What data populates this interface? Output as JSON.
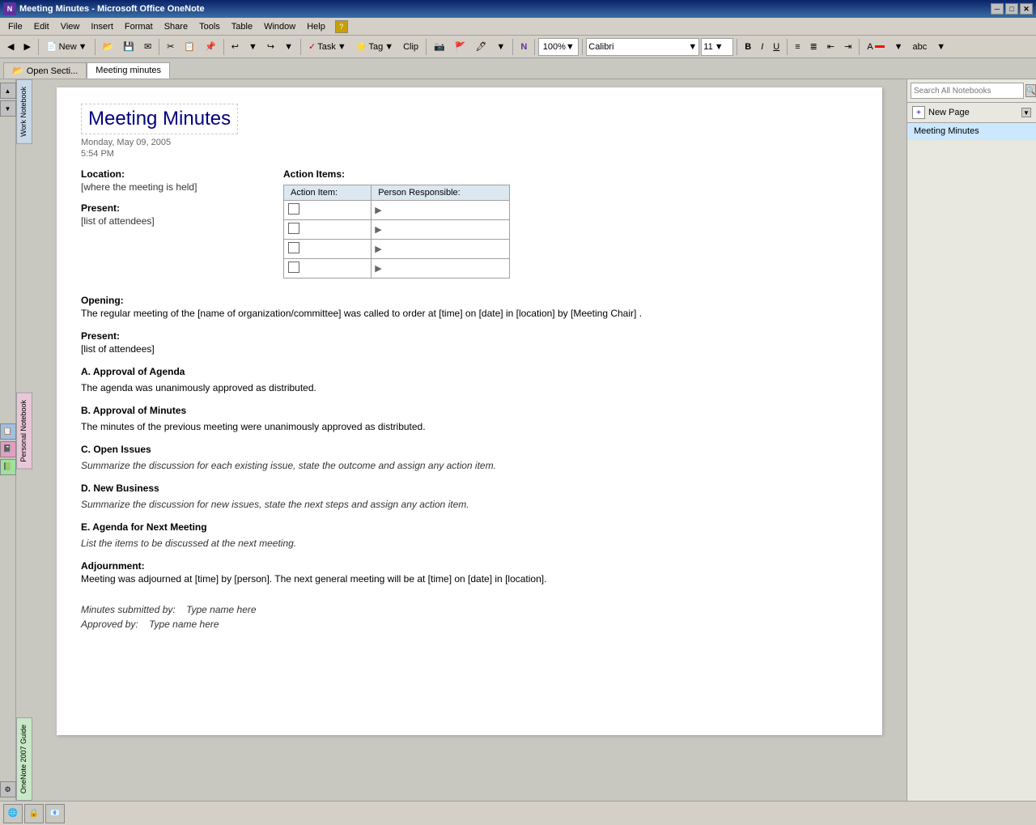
{
  "titlebar": {
    "title": "Meeting Minutes - Microsoft Office OneNote",
    "min_btn": "─",
    "max_btn": "□",
    "close_btn": "✕"
  },
  "menubar": {
    "items": [
      "File",
      "Edit",
      "View",
      "Insert",
      "Format",
      "Share",
      "Tools",
      "Table",
      "Window",
      "Help"
    ]
  },
  "toolbar": {
    "new_label": "New",
    "zoom_value": "100%",
    "font_name": "Calibri",
    "font_size": "11",
    "task_label": "Task",
    "tag_label": "Tag",
    "clip_label": "Clip"
  },
  "tabs": {
    "open_section": "Open Secti...",
    "active_tab": "Meeting minutes"
  },
  "sidebar": {
    "work_notebook": "Work Notebook",
    "personal_notebook": "Personal Notebook",
    "guide": "OneNote 2007 Guide"
  },
  "right_panel": {
    "search_placeholder": "Search All Notebooks",
    "new_page_label": "New Page",
    "pages": [
      "Meeting Minutes"
    ]
  },
  "document": {
    "title": "Meeting Minutes",
    "date": "Monday, May 09, 2005",
    "time": "5:54 PM",
    "location_label": "Location:",
    "location_value": "[where the meeting is held]",
    "present_label": "Present:",
    "present_value": "[list of attendees]",
    "action_items": {
      "title": "Action Items:",
      "col1": "Action Item:",
      "col2": "Person Responsible:",
      "rows": 4
    },
    "opening_label": "Opening:",
    "opening_text": "The regular meeting of the [name of organization/committee]  was called to order at [time] on [date] in [location] by [Meeting Chair] .",
    "present2_label": "Present:",
    "present2_text": "[list of attendees]",
    "agenda_a_label": "A.   Approval of Agenda",
    "agenda_a_text": "The agenda was unanimously  approved as distributed.",
    "agenda_b_label": "B.   Approval of Minutes",
    "agenda_b_text": "The minutes  of the previous meeting were unanimously  approved as distributed.",
    "agenda_c_label": "C.   Open Issues",
    "agenda_c_text": "Summarize the discussion for each existing issue, state the outcome and assign any action item.",
    "agenda_d_label": "D.   New Business",
    "agenda_d_text": "Summarize the discussion for new issues, state the next steps and assign any action item.",
    "agenda_e_label": "E.   Agenda for Next Meeting",
    "agenda_e_text": "List the items to be discussed at the next meeting.",
    "adjournment_label": "Adjournment:",
    "adjournment_text": "Meeting was adjourned at [time] by [person]. The next general meeting will be at [time] on [date] in [location].",
    "submitted_label": "Minutes submitted by:",
    "submitted_value": "Type name here",
    "approved_label": "Approved by:",
    "approved_value": "Type name here"
  }
}
